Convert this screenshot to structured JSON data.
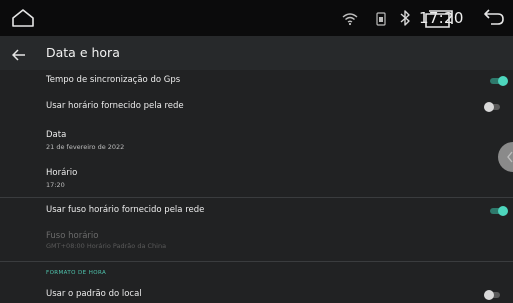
{
  "status_bar": {
    "time": "17:20",
    "icons": [
      "home-icon",
      "wifi-icon",
      "sim-icon",
      "bluetooth-icon",
      "recents-icon",
      "back-icon"
    ]
  },
  "header": {
    "title": "Data e hora",
    "back_icon": "arrow-left-icon"
  },
  "settings": {
    "gps_sync": {
      "label": "Tempo de sincronização do Gps",
      "enabled": true
    },
    "network_time": {
      "label": "Usar horário fornecido pela rede",
      "enabled": false
    },
    "date": {
      "label": "Data",
      "value": "21 de fevereiro de 2022"
    },
    "time": {
      "label": "Horário",
      "value": "17:20"
    },
    "network_timezone": {
      "label": "Usar fuso horário fornecido pela rede",
      "enabled": true
    },
    "timezone": {
      "label": "Fuso horário",
      "value": "GMT+08:00 Horário Padrão da China"
    },
    "time_format_section": "FORMATO DE HORA",
    "locale_default": {
      "label": "Usar o padrão do local",
      "enabled": false
    }
  },
  "colors": {
    "accent": "#4ed6bd",
    "background": "#212223",
    "status_bar": "#0b0b0c"
  }
}
